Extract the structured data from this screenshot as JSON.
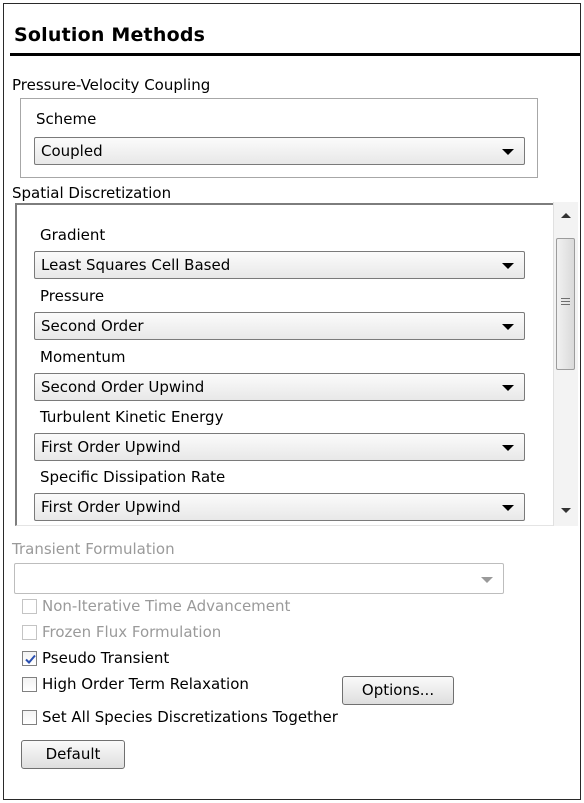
{
  "title": "Solution Methods",
  "pvc": {
    "group_label": "Pressure-Velocity Coupling",
    "scheme_label": "Scheme",
    "scheme_value": "Coupled"
  },
  "spatial": {
    "group_label": "Spatial Discretization",
    "fields": [
      {
        "label": "Gradient",
        "value": "Least Squares Cell Based"
      },
      {
        "label": "Pressure",
        "value": "Second Order"
      },
      {
        "label": "Momentum",
        "value": "Second Order Upwind"
      },
      {
        "label": "Turbulent Kinetic Energy",
        "value": "First Order Upwind"
      },
      {
        "label": "Specific Dissipation Rate",
        "value": "First Order Upwind"
      }
    ]
  },
  "transient": {
    "label": "Transient Formulation",
    "value": ""
  },
  "options": {
    "non_iterative": {
      "label": "Non-Iterative Time Advancement",
      "checked": false,
      "enabled": false
    },
    "frozen_flux": {
      "label": "Frozen Flux Formulation",
      "checked": false,
      "enabled": false
    },
    "pseudo_transient": {
      "label": "Pseudo Transient",
      "checked": true,
      "enabled": true
    },
    "high_order": {
      "label": "High Order Term Relaxation",
      "checked": false,
      "enabled": true
    },
    "species": {
      "label": "Set All Species Discretizations Together",
      "checked": false,
      "enabled": true
    }
  },
  "buttons": {
    "options_label": "Options...",
    "default_label": "Default"
  },
  "colors": {
    "check_mark": "#2a4fb0",
    "disabled_text": "#9a9a9a"
  }
}
